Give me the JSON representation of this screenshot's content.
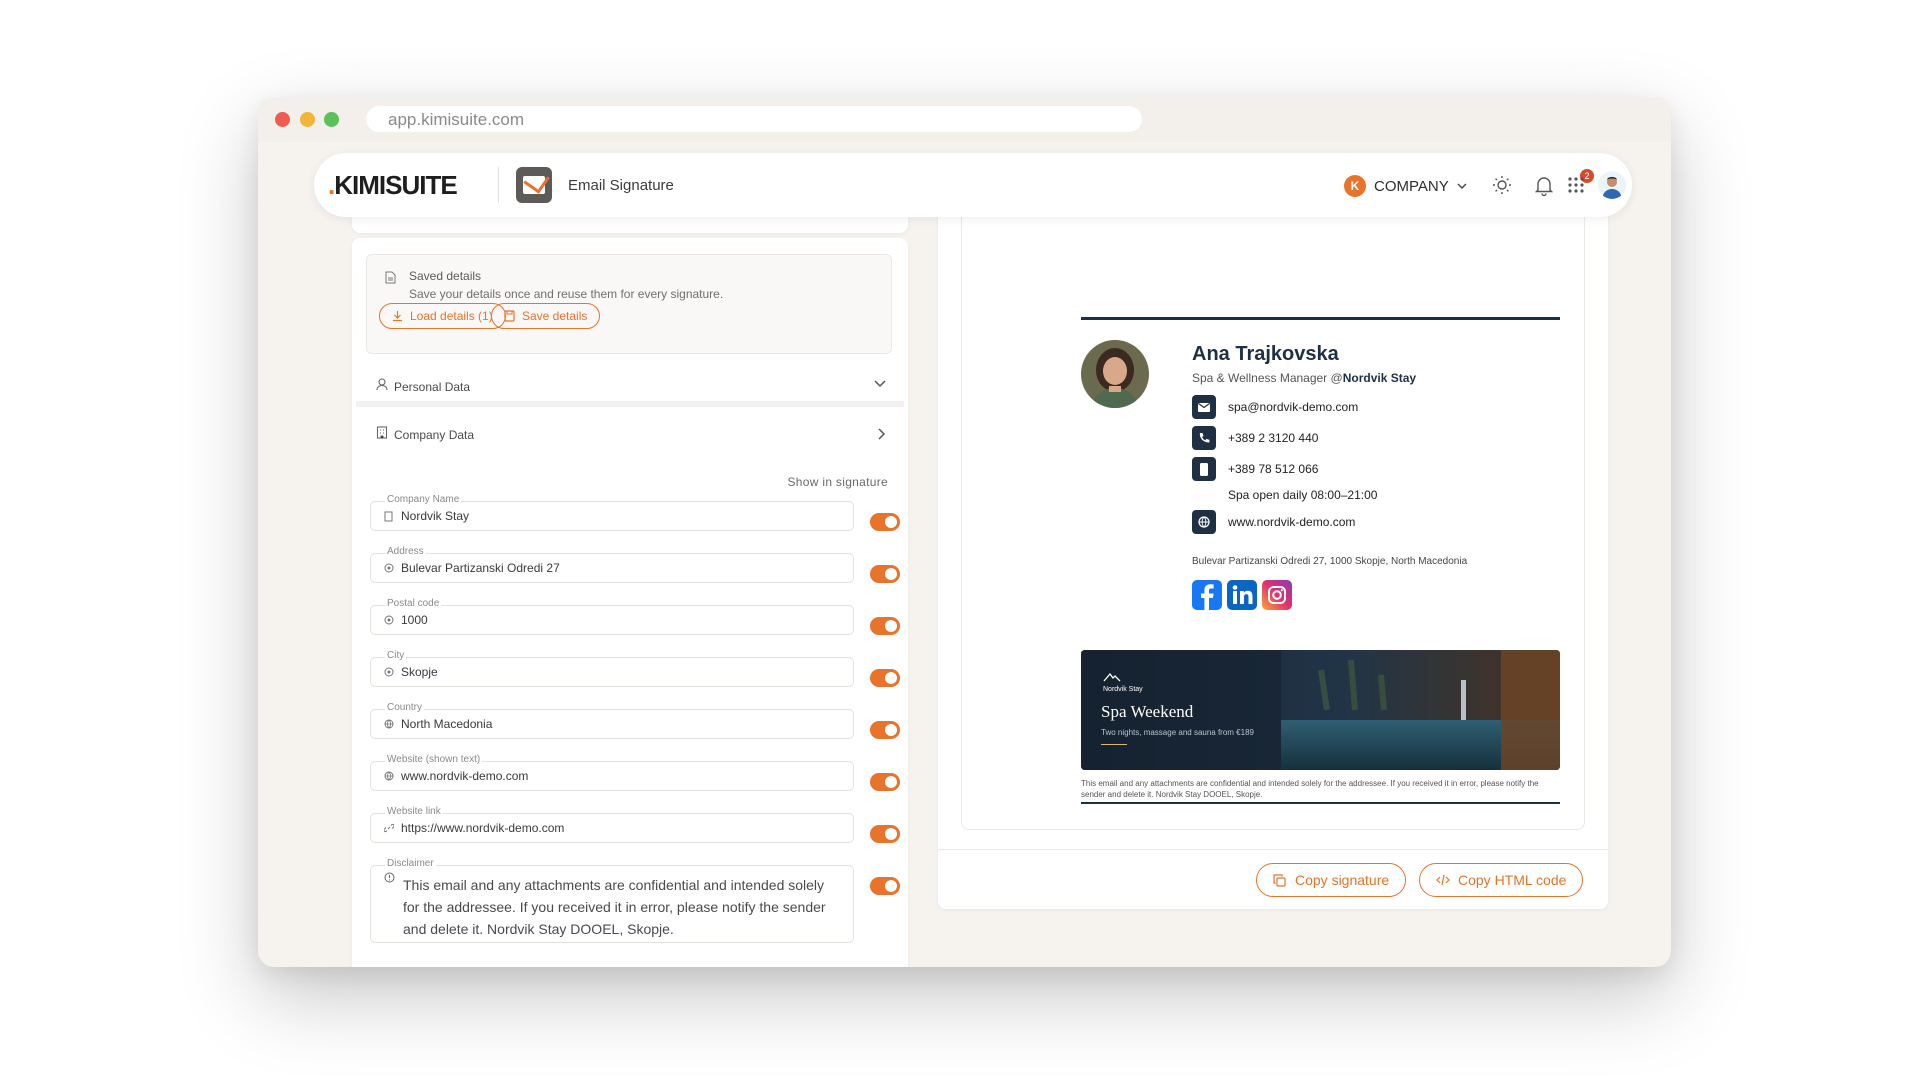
{
  "browser": {
    "url": "app.kimisuite.com"
  },
  "header": {
    "logo": "KIMISUITE",
    "app_title": "Email Signature",
    "company_initial": "K",
    "company_label": "COMPANY",
    "notification_count": "2"
  },
  "saved_details": {
    "title": "Saved details",
    "description": "Save your details once and reuse them for every signature.",
    "load_label": "Load details (1)",
    "save_label": "Save details"
  },
  "sections": {
    "personal": "Personal Data",
    "company": "Company Data",
    "show_in_signature": "Show in signature"
  },
  "fields": [
    {
      "label": "Company Name",
      "value": "Nordvik Stay",
      "icon": "building-icon",
      "shown": true
    },
    {
      "label": "Address",
      "value": "Bulevar Partizanski Odredi 27",
      "icon": "location-pin-icon",
      "shown": true
    },
    {
      "label": "Postal code",
      "value": "1000",
      "icon": "location-pin-icon",
      "shown": true
    },
    {
      "label": "City",
      "value": "Skopje",
      "icon": "location-pin-icon",
      "shown": true
    },
    {
      "label": "Country",
      "value": "North Macedonia",
      "icon": "globe-icon",
      "shown": true
    },
    {
      "label": "Website (shown text)",
      "value": "www.nordvik-demo.com",
      "icon": "globe-icon",
      "shown": true
    },
    {
      "label": "Website link",
      "value": "https://www.nordvik-demo.com",
      "icon": "link-icon",
      "shown": true
    },
    {
      "label": "Disclaimer",
      "value": "This email and any attachments are confidential and intended solely for the addressee. If you received it in error, please notify the sender and delete it. Nordvik Stay DOOEL, Skopje.",
      "icon": "info-icon",
      "shown": true
    }
  ],
  "signature": {
    "name": "Ana Trajkovska",
    "role": "Spa & Wellness Manager @",
    "company": "Nordvik Stay",
    "email": "spa@nordvik-demo.com",
    "phone": "+389 2 3120 440",
    "mobile": "+389 78 512 066",
    "hours": "Spa open daily 08:00–21:00",
    "website": "www.nordvik-demo.com",
    "address": "Bulevar Partizanski Odredi 27, 1000 Skopje, North Macedonia",
    "banner_brand": "Nordvik Stay",
    "banner_title": "Spa Weekend",
    "banner_subtitle": "Two nights, massage and sauna from €189",
    "disclaimer": "This email and any attachments are confidential and intended solely for the addressee. If you received it in error, please notify the sender and delete it. Nordvik Stay DOOEL, Skopje."
  },
  "actions": {
    "copy_signature": "Copy signature",
    "copy_html": "Copy HTML code"
  },
  "colors": {
    "accent": "#e8732a",
    "navy": "#1f2f44"
  }
}
